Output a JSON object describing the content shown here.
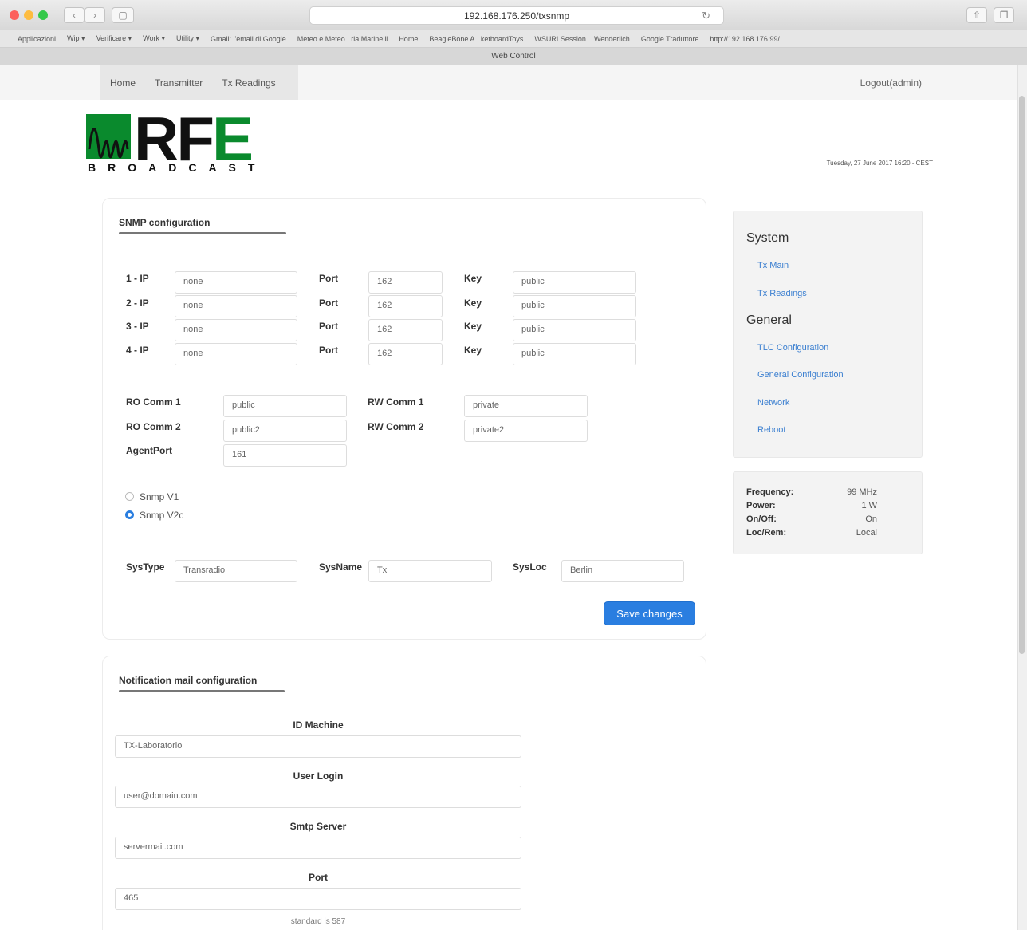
{
  "browser": {
    "url": "192.168.176.250/txsnmp",
    "tab_title": "Web Control",
    "bookmarks": [
      "Applicazioni",
      "Wip ▾",
      "Verificare ▾",
      "Work ▾",
      "Utility ▾",
      "Gmail: l'email di Google",
      "Meteo e Meteo...ria Marinelli",
      "Home",
      "BeagleBone A...ketboardToys",
      "WSURLSession... Wenderlich",
      "Google Traduttore",
      "http://192.168.176.99/"
    ]
  },
  "nav": {
    "items": [
      "Home",
      "Transmitter",
      "Tx Readings"
    ],
    "logout": "Logout(admin)"
  },
  "header": {
    "logo_main": "RF",
    "logo_e": "E",
    "logo_sub": "BROADCAST",
    "datetime": "Tuesday, 27 June 2017 16:20 - CEST"
  },
  "snmp": {
    "title": "SNMP configuration",
    "rows": [
      {
        "label": "1 - IP",
        "ip": "none",
        "port_label": "Port",
        "port": "162",
        "key_label": "Key",
        "key": "public"
      },
      {
        "label": "2 - IP",
        "ip": "none",
        "port_label": "Port",
        "port": "162",
        "key_label": "Key",
        "key": "public"
      },
      {
        "label": "3 - IP",
        "ip": "none",
        "port_label": "Port",
        "port": "162",
        "key_label": "Key",
        "key": "public"
      },
      {
        "label": "4 - IP",
        "ip": "none",
        "port_label": "Port",
        "port": "162",
        "key_label": "Key",
        "key": "public"
      }
    ],
    "ro_comm1_label": "RO Comm 1",
    "ro_comm1": "public",
    "ro_comm2_label": "RO Comm 2",
    "ro_comm2": "public2",
    "rw_comm1_label": "RW Comm 1",
    "rw_comm1": "private",
    "rw_comm2_label": "RW Comm 2",
    "rw_comm2": "private2",
    "agentport_label": "AgentPort",
    "agentport": "161",
    "versions": [
      {
        "label": "Snmp V1",
        "selected": false
      },
      {
        "label": "Snmp V2c",
        "selected": true
      }
    ],
    "systype_label": "SysType",
    "systype": "Transradio",
    "sysname_label": "SysName",
    "sysname": "Tx",
    "sysloc_label": "SysLoc",
    "sysloc": "Berlin",
    "save": "Save changes"
  },
  "sidebar": {
    "system_heading": "System",
    "system_links": [
      "Tx Main",
      "Tx Readings"
    ],
    "general_heading": "General",
    "general_links": [
      "TLC Configuration",
      "General Configuration",
      "Network"
    ],
    "reboot": "Reboot"
  },
  "status": {
    "items": [
      {
        "key": "Frequency:",
        "value": "99 MHz"
      },
      {
        "key": "Power:",
        "value": "1 W"
      },
      {
        "key": "On/Off:",
        "value": "On"
      },
      {
        "key": "Loc/Rem:",
        "value": "Local"
      }
    ]
  },
  "mail": {
    "title": "Notification mail configuration",
    "id_label": "ID Machine",
    "id": "TX-Laboratorio",
    "user_label": "User Login",
    "user": "user@domain.com",
    "smtp_label": "Smtp Server",
    "smtp": "servermail.com",
    "port_label": "Port",
    "port": "465",
    "port_hint": "standard is 587"
  },
  "colors": {
    "accent": "#2a7ee0",
    "logo_green": "#0a8a2d",
    "link": "#3b7fd0"
  }
}
